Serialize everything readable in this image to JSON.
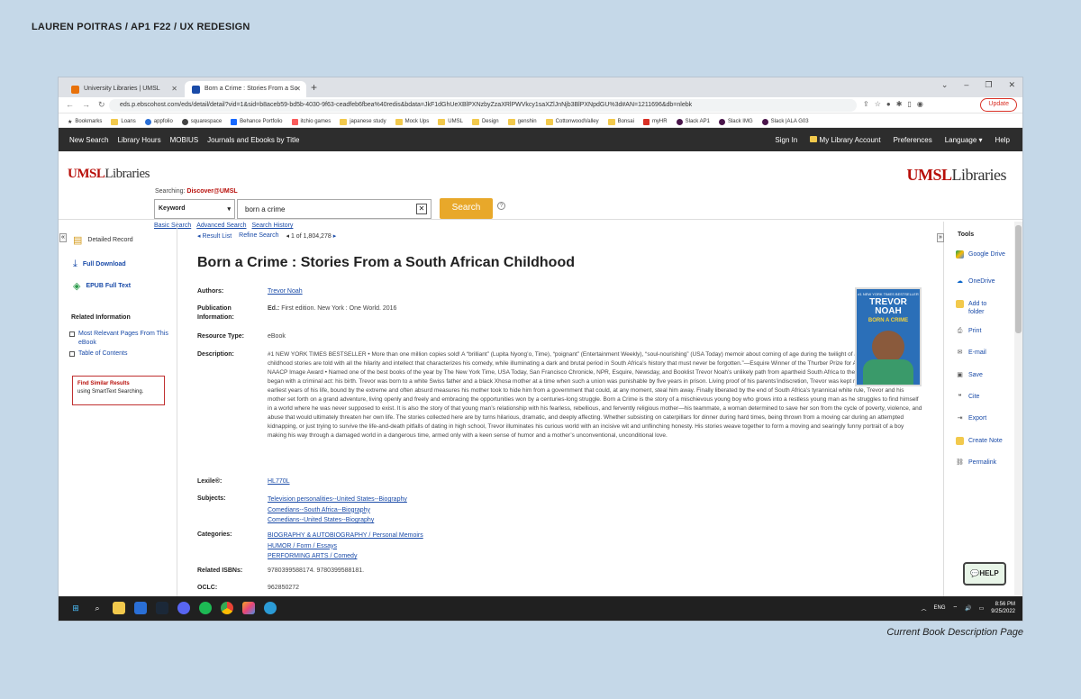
{
  "page": {
    "header": "LAUREN POITRAS / AP1 F22 / UX REDESIGN",
    "caption": "Current Book Description Page"
  },
  "browser": {
    "tabs": [
      {
        "label": "University Libraries | UMSL",
        "favicon_color": "#e8710a"
      },
      {
        "label": "Born a Crime : Stories From a So",
        "favicon_color": "#1a4ba8"
      }
    ],
    "url": "eds.p.ebscohost.com/eds/detail/detail?vid=1&sid=b8aceb59-bd5b-4030-9f63-ceadfeb6fbea%40redis&bdata=JkF1dGhUeXBlPXNzbyZzaXRlPWVkcy1saXZlJnNjb3BlPXNpdGU%3d#AN=1211696&db=nlebk",
    "update_label": "Update",
    "bookmarks": [
      "Bookmarks",
      "Loans",
      "appfolio",
      "squarespace",
      "Behance Portfolio",
      "itchio games",
      "japanese study",
      "Mock Ups",
      "UMSL",
      "Design",
      "genshin",
      "CottonwoodValley",
      "Bonsai",
      "myHR",
      "Slack AP1",
      "Slack IMG",
      "Slack |ALA G03"
    ]
  },
  "sitenav": {
    "left": [
      "New Search",
      "Library Hours",
      "MOBIUS",
      "Journals and Ebooks by Title"
    ],
    "right": [
      "Sign In",
      "My Library Account",
      "Preferences",
      "Language ▾",
      "Help"
    ]
  },
  "search": {
    "logo_umsl": "UMSL",
    "logo_libraries": "Libraries",
    "searching_label": "Searching:",
    "searching_target": "Discover@UMSL",
    "field_select": "Keyword",
    "query": "born a crime",
    "button": "Search",
    "links": [
      "Basic Search",
      "Advanced Search",
      "Search History"
    ]
  },
  "leftpanel": {
    "detailed_record": "Detailed Record",
    "full_download": "Full Download",
    "epub": "EPUB Full Text",
    "related_header": "Related Information",
    "related": [
      "Most Relevant Pages From This eBook",
      "Table of Contents"
    ],
    "find_similar_title": "Find Similar Results",
    "find_similar_sub": "using SmartText Searching."
  },
  "record": {
    "result_list": "◂ Result List",
    "refine": "Refine Search",
    "pager_prev": "◂",
    "pager": "1 of 1,804,278",
    "pager_next": "▸",
    "title": "Born a Crime : Stories From a South African Childhood",
    "authors_k": "Authors:",
    "authors_v": "Trevor Noah",
    "pub_k": "Publication Information:",
    "pub_ed": "Ed.:",
    "pub_v": "First edition. New York : One World. 2016",
    "type_k": "Resource Type:",
    "type_v": "eBook",
    "desc_k": "Description:",
    "desc_v": "#1 NEW YORK TIMES BESTSELLER • More than one million copies sold! A “brilliant” (Lupita Nyong’o, Time), “poignant” (Entertainment Weekly), “soul-nourishing” (USA Today) memoir about coming of age during the twilight of apartheid “Noah’s childhood stories are told with all the hilarity and intellect that characterizes his comedy, while illuminating a dark and brutal period in South Africa’s history that must never be forgotten.”—Esquire Winner of the Thurber Prize for American Humor and an NAACP Image Award • Named one of the best books of the year by The New York Time, USA Today, San Francisco Chronicle, NPR, Esquire, Newsday, and Booklist Trevor Noah’s unlikely path from apartheid South Africa to the desk of The Daily Show began with a criminal act: his birth. Trevor was born to a white Swiss father and a black Xhosa mother at a time when such a union was punishable by five years in prison. Living proof of his parents’indiscretion, Trevor was kept mostly indoors for the earliest years of his life, bound by the extreme and often absurd measures his mother took to hide him from a government that could, at any moment, steal him away. Finally liberated by the end of South Africa’s tyrannical white rule, Trevor and his mother set forth on a grand adventure, living openly and freely and embracing the opportunities won by a centuries-long struggle. Born a Crime is the story of a mischievous young boy who grows into a restless young man as he struggles to find himself in a world where he was never supposed to exist. It is also the story of that young man’s relationship with his fearless, rebellious, and fervently religious mother—his teammate, a woman determined to save her son from the cycle of poverty, violence, and abuse that would ultimately threaten her own life. The stories collected here are by turns hilarious, dramatic, and deeply affecting. Whether subsisting on caterpillars for dinner during hard times, being thrown from a moving car during an attempted kidnapping, or just trying to survive the life-and-death pitfalls of dating in high school, Trevor illuminates his curious world with an incisive wit and unflinching honesty. His stories weave together to form a moving and searingly funny portrait of a boy making his way through a damaged world in a dangerous time, armed only with a keen sense of humor and a mother’s unconventional, unconditional love.",
    "lexile_k": "Lexile®:",
    "lexile_v": "HL770L",
    "subjects_k": "Subjects:",
    "subjects": [
      "Television personalities--United States--Biography",
      "Comedians--South Africa--Biography",
      "Comedians--United States--Biography"
    ],
    "categories_k": "Categories:",
    "categories": [
      "BIOGRAPHY & AUTOBIOGRAPHY / Personal Memoirs",
      "HUMOR / Form / Essays",
      "PERFORMING ARTS / Comedy"
    ],
    "isbn_k": "Related ISBNs:",
    "isbn_v": "9780399588174. 9780399588181.",
    "oclc_k": "OCLC:",
    "oclc_v": "962850272",
    "cover_top": "#1 NEW YORK TIMES BESTSELLER",
    "cover_name": "TREVOR NOAH",
    "cover_title": "BORN A CRIME"
  },
  "tools": {
    "header": "Tools",
    "items": [
      "Google Drive",
      "OneDrive",
      "Add to folder",
      "Print",
      "E-mail",
      "Save",
      "Cite",
      "Export",
      "Create Note",
      "Permalink"
    ]
  },
  "help_label": "HELP",
  "taskbar": {
    "lang": "ENG",
    "time": "8:56 PM",
    "date": "9/25/2022"
  }
}
